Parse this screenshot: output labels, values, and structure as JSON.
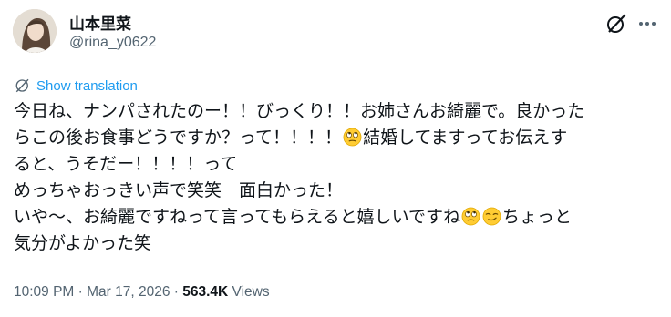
{
  "author": {
    "display_name": "山本里菜",
    "handle": "@rina_y0622"
  },
  "header": {
    "grok_icon": "grok-icon",
    "more_icon": "more-horizontal-icon"
  },
  "translation": {
    "label": "Show translation",
    "icon": "globe-icon"
  },
  "tweet": {
    "lines": [
      [
        "今日ね、ナンパされたのー！！びっくり！！お姉さんお綺麗で。良かった"
      ],
      [
        "らこの後お食事どうですか？って！！！！",
        "emoji:face-with-rolling-eyes",
        "結婚してますってお伝えす"
      ],
      [
        "ると、うそだー！！！！って"
      ],
      [
        "めっちゃおっきい声で笑笑　面白かった！"
      ],
      [
        "いや〜、お綺麗ですねって言ってもらえると嬉しいですね",
        "emoji:face-with-rolling-eyes",
        "emoji:smirking-face",
        "ちょっと"
      ],
      [
        "気分がよかった笑"
      ]
    ]
  },
  "meta": {
    "time": "10:09 PM",
    "separator_1": " · ",
    "date": "Mar 17, 2026",
    "separator_2": " · ",
    "views_count": "563.4K",
    "views_label": " Views"
  },
  "colors": {
    "text": "#0f1419",
    "secondary": "#536471",
    "accent": "#1d9bf0"
  }
}
